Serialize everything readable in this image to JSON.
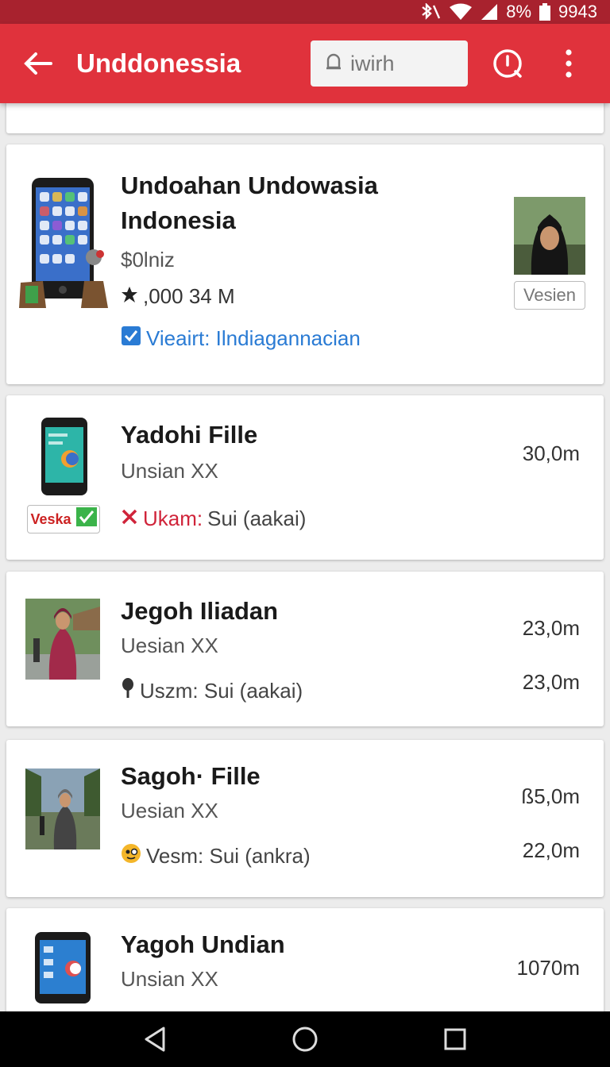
{
  "status_bar": {
    "battery_text": "8%",
    "time": "9943"
  },
  "app_bar": {
    "title": "Unddonessia",
    "search_placeholder": "iwirh"
  },
  "items": [
    {
      "title_line1": "Undoahan Undowasia",
      "title_line2": "Indonesia",
      "price": "$0lniz",
      "count": ",000 34 M",
      "status": "Vieairt: Ilndiagannacian",
      "side_label": "Vesien"
    },
    {
      "title": "Yadohi Fille",
      "subtitle": "Unsian XX",
      "status_label": "Ukam:",
      "status_value": "Sui (aakai)",
      "value": "30,0m",
      "badge": "Veska"
    },
    {
      "title": "Jegoh Iliadan",
      "subtitle": "Uesian XX",
      "status_text": "Uszm: Sui (aakai)",
      "value1": "23,0m",
      "value2": "23,0m"
    },
    {
      "title": "Sagoh· Fille",
      "subtitle": "Uesian XX",
      "status_text": "Vesm: Sui (ankra)",
      "value1": "ß5,0m",
      "value2": "22,0m"
    },
    {
      "title": "Yagoh Undian",
      "subtitle": "Unsian XX",
      "value": "1070m"
    }
  ],
  "colors": {
    "appbar": "#e0323c",
    "statusbar": "#a8222e",
    "check": "#2a7bd4",
    "error": "#d0243a"
  }
}
